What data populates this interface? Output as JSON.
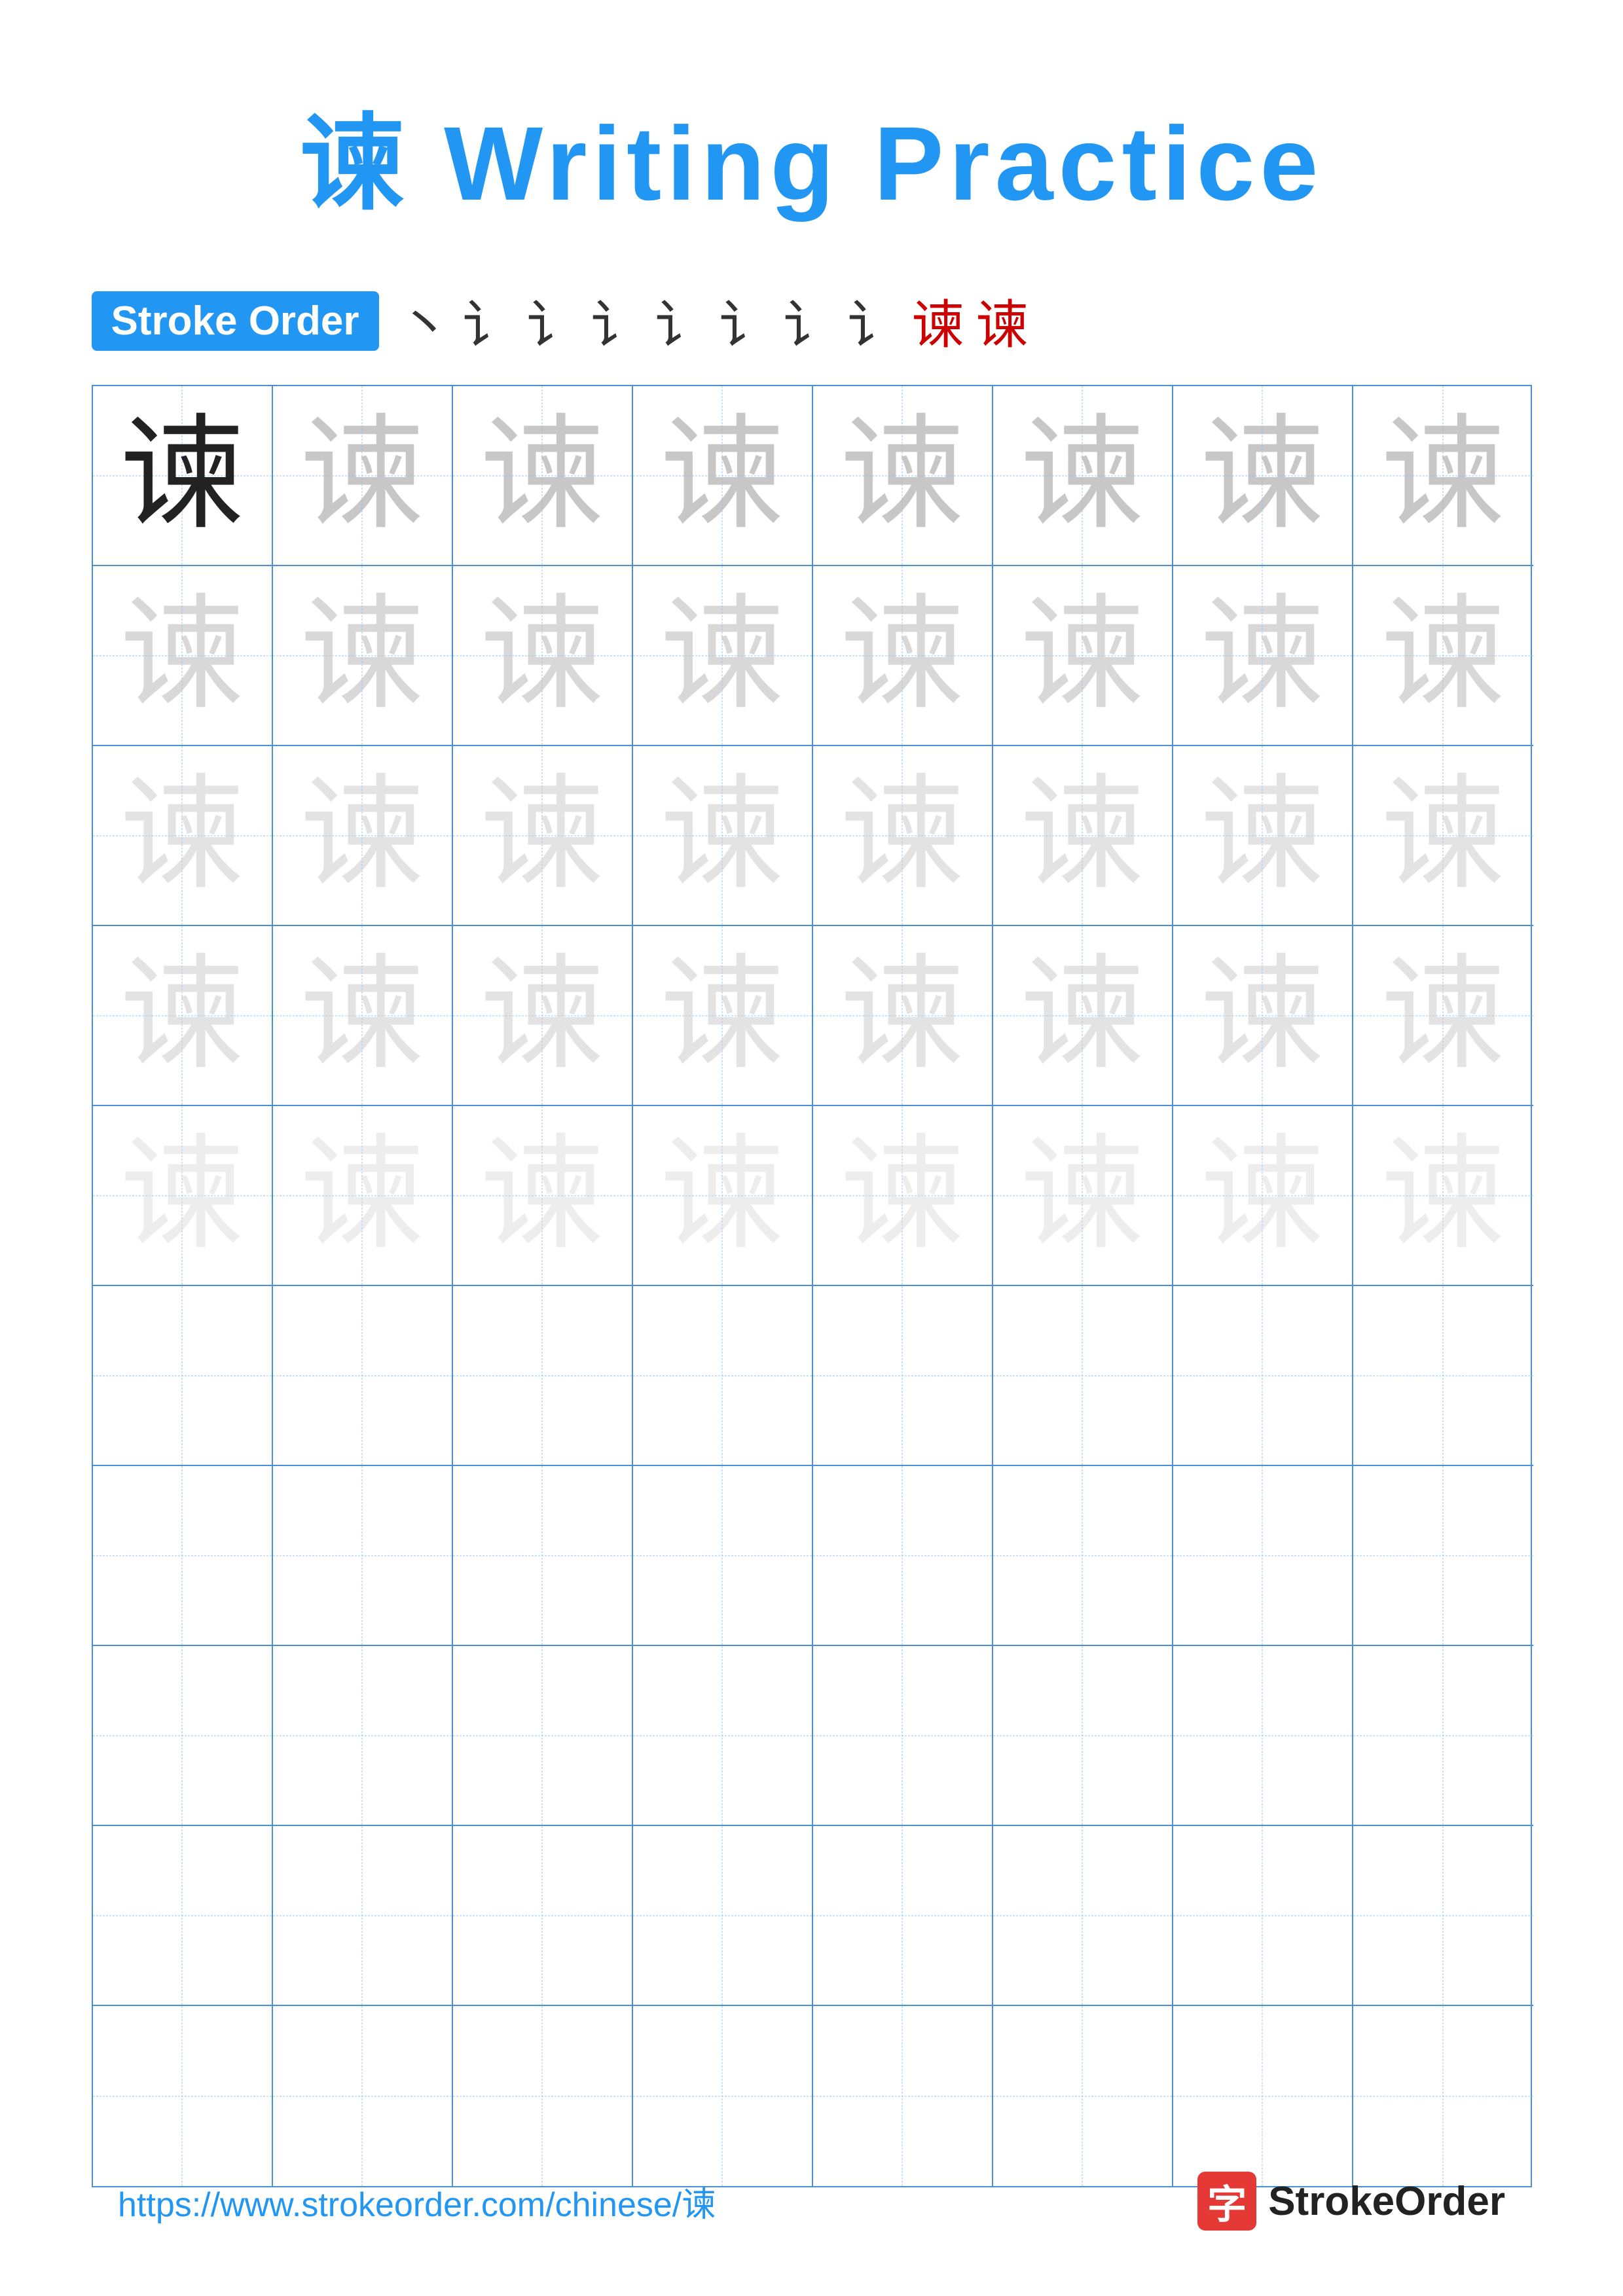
{
  "title": "谏 Writing Practice",
  "stroke_order_badge": "Stroke Order",
  "stroke_sequence": [
    "丶",
    "讠",
    "讠",
    "讠",
    "讠",
    "讠",
    "讠",
    "讠",
    "谏",
    "谏"
  ],
  "character": "谏",
  "rows": [
    {
      "cells": [
        {
          "char": "谏",
          "style": "dark"
        },
        {
          "char": "谏",
          "style": "light-1"
        },
        {
          "char": "谏",
          "style": "light-1"
        },
        {
          "char": "谏",
          "style": "light-1"
        },
        {
          "char": "谏",
          "style": "light-1"
        },
        {
          "char": "谏",
          "style": "light-1"
        },
        {
          "char": "谏",
          "style": "light-1"
        },
        {
          "char": "谏",
          "style": "light-1"
        }
      ]
    },
    {
      "cells": [
        {
          "char": "谏",
          "style": "light-2"
        },
        {
          "char": "谏",
          "style": "light-2"
        },
        {
          "char": "谏",
          "style": "light-2"
        },
        {
          "char": "谏",
          "style": "light-2"
        },
        {
          "char": "谏",
          "style": "light-2"
        },
        {
          "char": "谏",
          "style": "light-2"
        },
        {
          "char": "谏",
          "style": "light-2"
        },
        {
          "char": "谏",
          "style": "light-2"
        }
      ]
    },
    {
      "cells": [
        {
          "char": "谏",
          "style": "light-3"
        },
        {
          "char": "谏",
          "style": "light-3"
        },
        {
          "char": "谏",
          "style": "light-3"
        },
        {
          "char": "谏",
          "style": "light-3"
        },
        {
          "char": "谏",
          "style": "light-3"
        },
        {
          "char": "谏",
          "style": "light-3"
        },
        {
          "char": "谏",
          "style": "light-3"
        },
        {
          "char": "谏",
          "style": "light-3"
        }
      ]
    },
    {
      "cells": [
        {
          "char": "谏",
          "style": "light-3"
        },
        {
          "char": "谏",
          "style": "light-3"
        },
        {
          "char": "谏",
          "style": "light-3"
        },
        {
          "char": "谏",
          "style": "light-3"
        },
        {
          "char": "谏",
          "style": "light-3"
        },
        {
          "char": "谏",
          "style": "light-3"
        },
        {
          "char": "谏",
          "style": "light-3"
        },
        {
          "char": "谏",
          "style": "light-3"
        }
      ]
    },
    {
      "cells": [
        {
          "char": "谏",
          "style": "light-4"
        },
        {
          "char": "谏",
          "style": "light-4"
        },
        {
          "char": "谏",
          "style": "light-4"
        },
        {
          "char": "谏",
          "style": "light-4"
        },
        {
          "char": "谏",
          "style": "light-4"
        },
        {
          "char": "谏",
          "style": "light-4"
        },
        {
          "char": "谏",
          "style": "light-4"
        },
        {
          "char": "谏",
          "style": "light-4"
        }
      ]
    },
    {
      "cells": [
        {
          "char": "",
          "style": "empty"
        },
        {
          "char": "",
          "style": "empty"
        },
        {
          "char": "",
          "style": "empty"
        },
        {
          "char": "",
          "style": "empty"
        },
        {
          "char": "",
          "style": "empty"
        },
        {
          "char": "",
          "style": "empty"
        },
        {
          "char": "",
          "style": "empty"
        },
        {
          "char": "",
          "style": "empty"
        }
      ]
    },
    {
      "cells": [
        {
          "char": "",
          "style": "empty"
        },
        {
          "char": "",
          "style": "empty"
        },
        {
          "char": "",
          "style": "empty"
        },
        {
          "char": "",
          "style": "empty"
        },
        {
          "char": "",
          "style": "empty"
        },
        {
          "char": "",
          "style": "empty"
        },
        {
          "char": "",
          "style": "empty"
        },
        {
          "char": "",
          "style": "empty"
        }
      ]
    },
    {
      "cells": [
        {
          "char": "",
          "style": "empty"
        },
        {
          "char": "",
          "style": "empty"
        },
        {
          "char": "",
          "style": "empty"
        },
        {
          "char": "",
          "style": "empty"
        },
        {
          "char": "",
          "style": "empty"
        },
        {
          "char": "",
          "style": "empty"
        },
        {
          "char": "",
          "style": "empty"
        },
        {
          "char": "",
          "style": "empty"
        }
      ]
    },
    {
      "cells": [
        {
          "char": "",
          "style": "empty"
        },
        {
          "char": "",
          "style": "empty"
        },
        {
          "char": "",
          "style": "empty"
        },
        {
          "char": "",
          "style": "empty"
        },
        {
          "char": "",
          "style": "empty"
        },
        {
          "char": "",
          "style": "empty"
        },
        {
          "char": "",
          "style": "empty"
        },
        {
          "char": "",
          "style": "empty"
        }
      ]
    },
    {
      "cells": [
        {
          "char": "",
          "style": "empty"
        },
        {
          "char": "",
          "style": "empty"
        },
        {
          "char": "",
          "style": "empty"
        },
        {
          "char": "",
          "style": "empty"
        },
        {
          "char": "",
          "style": "empty"
        },
        {
          "char": "",
          "style": "empty"
        },
        {
          "char": "",
          "style": "empty"
        },
        {
          "char": "",
          "style": "empty"
        }
      ]
    }
  ],
  "footer": {
    "url": "https://www.strokeorder.com/chinese/谏",
    "brand_char": "字",
    "brand_name": "StrokeOrder"
  }
}
